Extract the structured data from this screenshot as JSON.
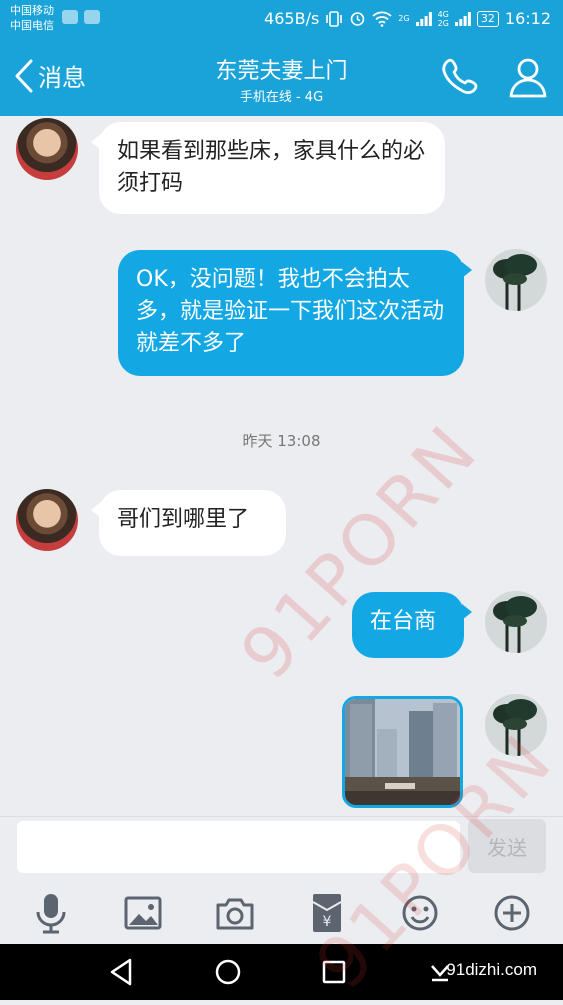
{
  "status_bar": {
    "carrier_1": "中国移动",
    "carrier_2": "中国电信",
    "speed": "465B/s",
    "network_1": "2G",
    "network_2": "4G",
    "network_3": "2G",
    "battery": "32",
    "time": "16:12"
  },
  "header": {
    "back_label": "消息",
    "title": "东莞夫妻上门",
    "subtitle": "手机在线 - 4G"
  },
  "messages": [
    {
      "side": "in",
      "text": "如果看到那些床，家具什么的必须打码"
    },
    {
      "side": "out",
      "text": "OK，没问题！我也不会拍太多，就是验证一下我们这次活动就差不多了"
    },
    {
      "side": "in",
      "text": "哥们到哪里了"
    },
    {
      "side": "out",
      "text": "在台商"
    }
  ],
  "timestamp": "昨天 13:08",
  "input": {
    "placeholder": "",
    "send_label": "发送"
  },
  "toolbar": [
    "mic-icon",
    "image-icon",
    "camera-icon",
    "red-packet-icon",
    "emoji-icon",
    "plus-icon"
  ],
  "nav": {
    "site_label": "91dizhi.com"
  },
  "watermark": "91PORN",
  "colors": {
    "accent": "#1aa3d8",
    "bubble_out": "#13a8e4",
    "background": "#ebedf1"
  }
}
